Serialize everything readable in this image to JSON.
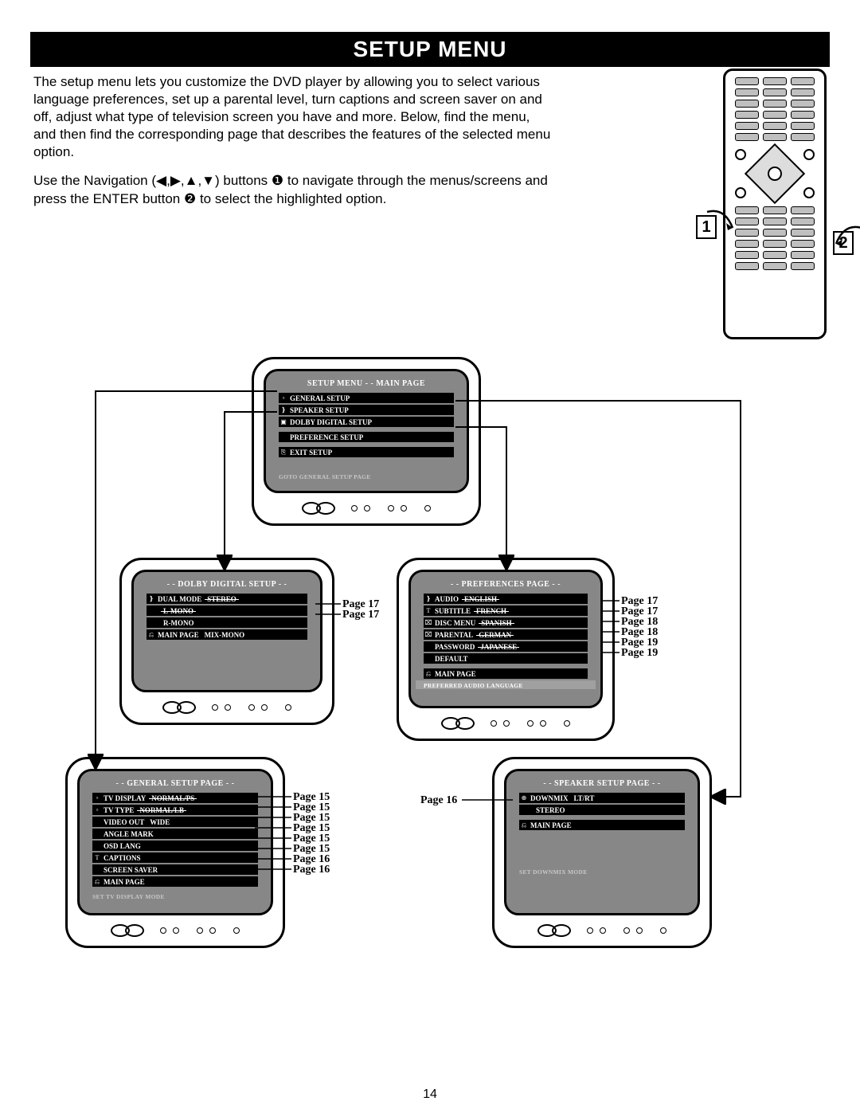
{
  "title": "SETUP MENU",
  "intro": {
    "p1": "The setup menu lets you customize the DVD player by allowing you to select various language preferences, set up a parental level, turn captions and screen saver on and off, adjust what type of television screen you have and more. Below, find the menu, and then find the corresponding page that describes the features of the selected menu option.",
    "p2_pre": "Use the Navigation (",
    "p2_mid": ") buttons ",
    "p2_num1": "❶",
    "p2_after1": " to navigate through the menus/screens and press the ENTER button ",
    "p2_num2": "❷",
    "p2_after2": " to select the highlighted option.",
    "arrows": "◀,▶,▲,▼"
  },
  "remote_callouts": {
    "left": "1",
    "right": "2"
  },
  "page_number": "14",
  "tv_main": {
    "title": "SETUP MENU  - - MAIN PAGE",
    "items": [
      {
        "ico": "▫",
        "label": "GENERAL  SETUP"
      },
      {
        "ico": "❵",
        "label": "SPEAKER SETUP"
      },
      {
        "ico": "▣",
        "label": "DOLBY DIGITAL SETUP"
      },
      {
        "gap": true,
        "ico": " ",
        "label": "PREFERENCE SETUP"
      },
      {
        "gap": true,
        "ico": "⎘",
        "label": "EXIT SETUP"
      }
    ],
    "hint": "GOTO GENERAL SETUP PAGE"
  },
  "tv_dolby": {
    "title": "- -  DOLBY DIGITAL SETUP  - -",
    "items": [
      {
        "ico": "❵",
        "label": "DUAL MODE",
        "value": "STEREO",
        "strike": true
      },
      {
        "ico": " ",
        "label": " ",
        "value": "L-MONO",
        "strike": true
      },
      {
        "ico": " ",
        "label": " ",
        "value": "R-MONO"
      },
      {
        "ico": "⎌",
        "label": "MAIN PAGE",
        "value": "MIX-MONO"
      }
    ],
    "pages": [
      "Page 17",
      "Page 17"
    ]
  },
  "tv_pref": {
    "title": "- - PREFERENCES PAGE - -",
    "items": [
      {
        "ico": "❵",
        "label": "AUDIO",
        "value": "ENGLISH",
        "strike": true
      },
      {
        "ico": "T",
        "label": "SUBTITLE",
        "value": "FRENCH",
        "strike": true
      },
      {
        "ico": "⌧",
        "label": "DISC MENU",
        "value": "SPANISH",
        "strike": true
      },
      {
        "ico": "⌧",
        "label": "PARENTAL",
        "value": "GERMAN",
        "strike": true
      },
      {
        "ico": " ",
        "label": "PASSWORD",
        "value": "JAPANESE",
        "strike": true
      },
      {
        "ico": " ",
        "label": "DEFAULT"
      },
      {
        "gap": true,
        "ico": "⎌",
        "label": "MAIN PAGE"
      }
    ],
    "hint": "PREFERRED AUDIO LANGUAGE",
    "pages": [
      "Page 17",
      "Page 17",
      "Page 18",
      "Page 18",
      "Page 19",
      "Page 19"
    ]
  },
  "tv_general": {
    "title": "- - GENERAL SETUP PAGE - -",
    "items": [
      {
        "ico": "▫",
        "label": "TV DISPLAY",
        "value": "NORMAL/PS",
        "strike": true
      },
      {
        "ico": "▫",
        "label": "TV TYPE",
        "value": "NORMAL/LB",
        "strike": true
      },
      {
        "ico": " ",
        "label": "VIDEO OUT",
        "value": "WIDE"
      },
      {
        "ico": " ",
        "label": "ANGLE MARK"
      },
      {
        "ico": " ",
        "label": "OSD LANG"
      },
      {
        "ico": "T",
        "label": "CAPTIONS"
      },
      {
        "ico": " ",
        "label": "SCREEN SAVER"
      },
      {
        "ico": "⎌",
        "label": "MAIN PAGE"
      }
    ],
    "hint": "SET TV DISPLAY MODE",
    "pages": [
      "Page 15",
      "Page 15",
      "Page 15",
      "Page 15",
      "Page 15",
      "Page 15",
      "Page 16",
      "Page 16"
    ]
  },
  "tv_speaker": {
    "title": "- - SPEAKER SETUP PAGE - -",
    "items": [
      {
        "ico": "⊕",
        "label": "DOWNMIX",
        "value": "LT/RT"
      },
      {
        "ico": " ",
        "label": " ",
        "value": "STEREO"
      },
      {
        "ico": "⎌",
        "label": "MAIN PAGE",
        "gap": true
      }
    ],
    "hint": "SET DOWNMIX MODE",
    "page": "Page 16"
  }
}
